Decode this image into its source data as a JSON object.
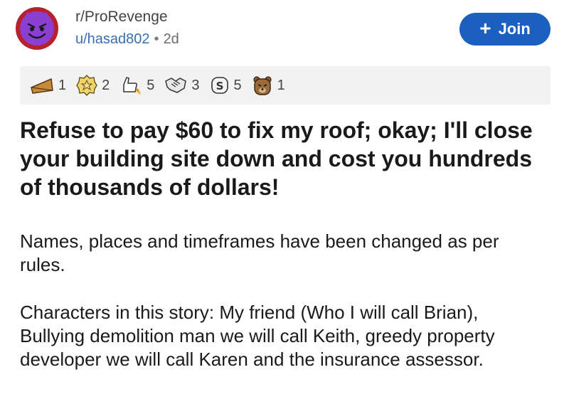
{
  "post_header": {
    "subreddit": "r/ProRevenge",
    "username": "u/hasad802",
    "separator": "•",
    "age": "2d",
    "join_label": "Join",
    "join_icon": "plus-icon"
  },
  "awards": [
    {
      "icon": "cheese-wedge-award-icon",
      "count": "1"
    },
    {
      "icon": "gold-star-badge-award-icon",
      "count": "2"
    },
    {
      "icon": "rocket-thumbs-award-icon",
      "count": "5"
    },
    {
      "icon": "handshake-award-icon",
      "count": "3"
    },
    {
      "icon": "money-bag-award-icon",
      "count": "5"
    },
    {
      "icon": "angry-bear-award-icon",
      "count": "1"
    }
  ],
  "post": {
    "title": "Refuse to pay $60 to fix my roof; okay; I'll close your building site down and cost you hundreds of thousands of dollars!",
    "paragraphs": [
      "Names, places and timeframes have been changed as per rules.",
      "Characters in this story: My friend (Who I will call Brian), Bullying demolition man we will call Keith, greedy property developer we will call Karen and the insurance assessor."
    ]
  },
  "colors": {
    "accent": "#1b5fc0",
    "avatar_ring": "#b8202b",
    "avatar_face": "#8a3fd1",
    "awards_bg": "#f2f2f2",
    "username": "#3a6fb0"
  }
}
